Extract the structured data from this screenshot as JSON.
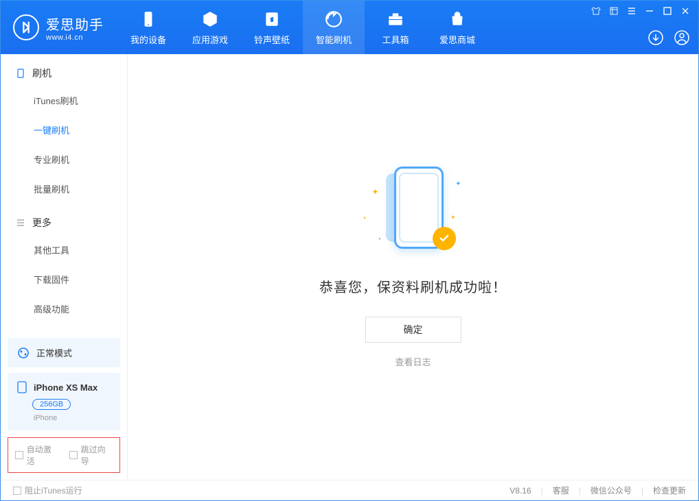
{
  "app": {
    "title": "爱思助手",
    "url": "www.i4.cn"
  },
  "nav": {
    "tabs": [
      {
        "label": "我的设备"
      },
      {
        "label": "应用游戏"
      },
      {
        "label": "铃声壁纸"
      },
      {
        "label": "智能刷机",
        "active": true
      },
      {
        "label": "工具箱"
      },
      {
        "label": "爱思商城"
      }
    ]
  },
  "sidebar": {
    "sections": [
      {
        "title": "刷机",
        "items": [
          "iTunes刷机",
          "一键刷机",
          "专业刷机",
          "批量刷机"
        ]
      },
      {
        "title": "更多",
        "items": [
          "其他工具",
          "下载固件",
          "高级功能"
        ]
      }
    ],
    "mode_label": "正常模式",
    "device": {
      "name": "iPhone XS Max",
      "capacity": "256GB",
      "type": "iPhone"
    },
    "checkboxes": {
      "auto_activate": "自动激活",
      "skip_guide": "跳过向导"
    }
  },
  "main": {
    "success_text": "恭喜您，保资料刷机成功啦！",
    "confirm_label": "确定",
    "log_label": "查看日志"
  },
  "footer": {
    "block_itunes": "阻止iTunes运行",
    "version": "V8.16",
    "links": [
      "客服",
      "微信公众号",
      "检查更新"
    ]
  }
}
